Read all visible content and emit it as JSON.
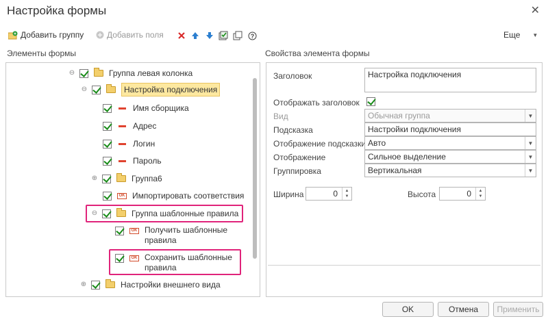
{
  "window": {
    "title": "Настройка формы",
    "close_glyph": "✕"
  },
  "toolbar": {
    "add_group": "Добавить группу",
    "add_fields": "Добавить поля",
    "more": "Еще"
  },
  "left": {
    "caption": "Элементы формы",
    "tree": [
      {
        "label": "Группа левая колонка"
      },
      {
        "label": "Настройка подключения"
      },
      {
        "label": "Имя сборщика"
      },
      {
        "label": "Адрес"
      },
      {
        "label": "Логин"
      },
      {
        "label": "Пароль"
      },
      {
        "label": "Группа6"
      },
      {
        "label": "Импортировать соответствия"
      },
      {
        "label": "Группа шаблонные правила"
      },
      {
        "label": "Получить шаблонные правила"
      },
      {
        "label": "Сохранить шаблонные правила"
      },
      {
        "label": "Настройки внешнего вида"
      }
    ],
    "ok_glyph": "OK"
  },
  "right": {
    "caption": "Свойства элемента формы",
    "props": {
      "heading_label": "Заголовок",
      "heading_value": "Настройка подключения",
      "show_heading_label": "Отображать заголовок",
      "view_label": "Вид",
      "view_value": "Обычная группа",
      "tooltip_label": "Подсказка",
      "tooltip_value": "Настройки подключения",
      "tooltip_display_label": "Отображение подсказки",
      "tooltip_display_value": "Авто",
      "display_label": "Отображение",
      "display_value": "Сильное выделение",
      "grouping_label": "Группировка",
      "grouping_value": "Вертикальная",
      "width_label": "Ширина",
      "width_value": "0",
      "height_label": "Высота",
      "height_value": "0"
    }
  },
  "buttons": {
    "ok": "OK",
    "cancel": "Отмена",
    "apply": "Применить"
  },
  "colors": {
    "highlight": "#e0237a",
    "selected": "#fde8a0"
  }
}
